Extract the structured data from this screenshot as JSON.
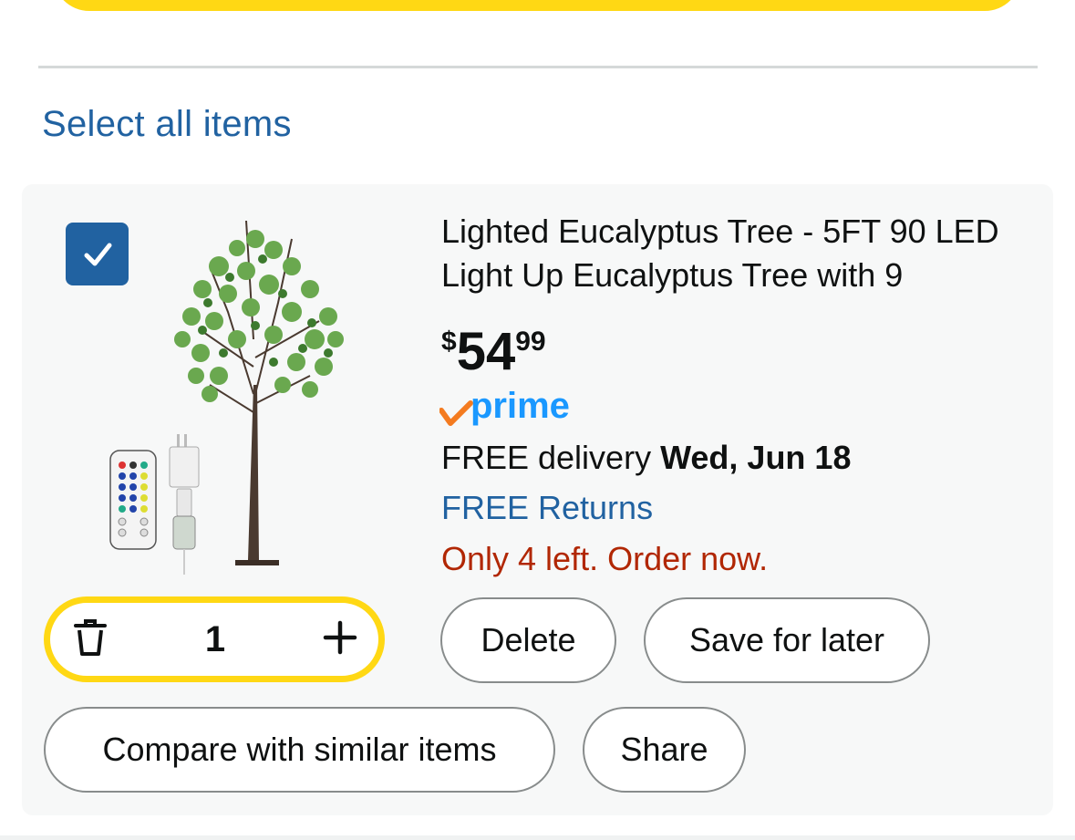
{
  "header": {
    "select_all": "Select all items"
  },
  "item": {
    "checked": true,
    "title": "Lighted Eucalyptus Tree - 5FT 90 LED Light Up Eucalyptus Tree with 9",
    "price": {
      "currency": "$",
      "whole": "54",
      "fraction": "99"
    },
    "prime_label": "prime",
    "delivery": {
      "prefix": "FREE delivery",
      "date": "Wed, Jun 18"
    },
    "returns": "FREE Returns",
    "stock": "Only 4 left. Order now.",
    "quantity": "1"
  },
  "actions": {
    "delete": "Delete",
    "save_for_later": "Save for later",
    "compare": "Compare with similar items",
    "share": "Share"
  },
  "colors": {
    "accent_yellow": "#ffd814",
    "link_blue": "#2162a1",
    "stock_red": "#b12704",
    "prime_blue": "#1a98ff",
    "prime_check": "#f47b20"
  }
}
